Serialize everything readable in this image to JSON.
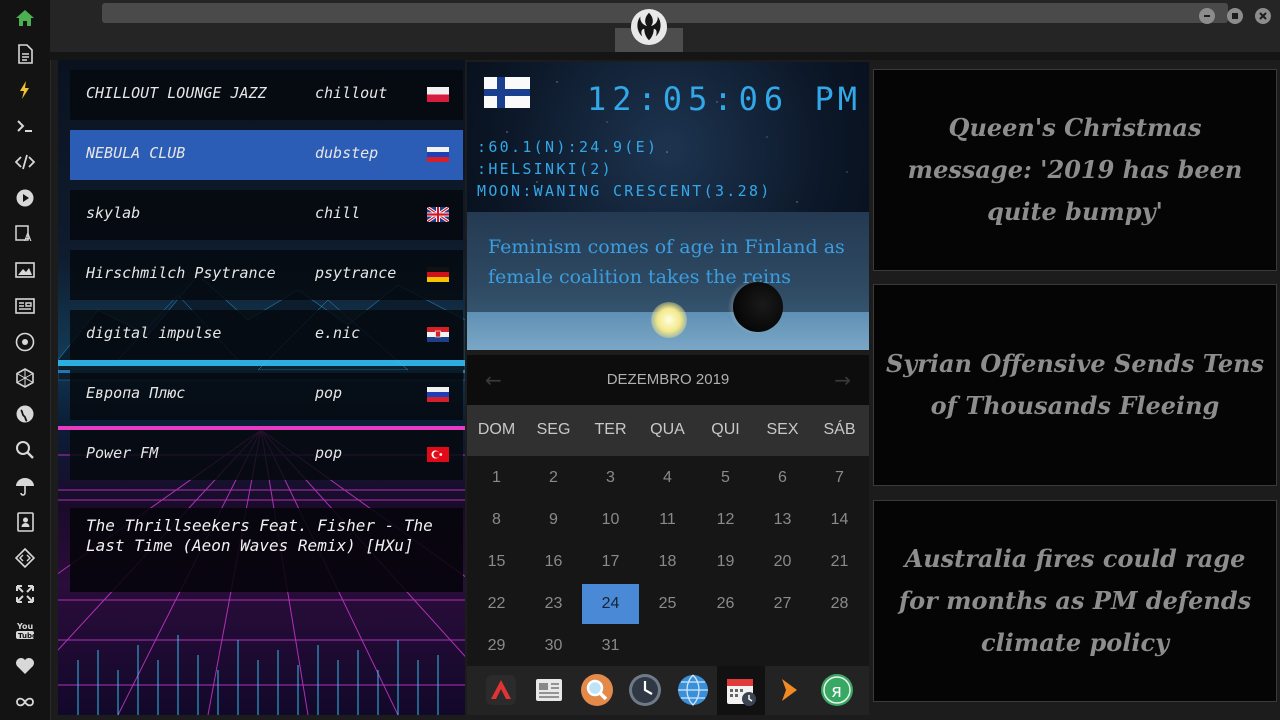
{
  "sidebar": {
    "items": [
      {
        "icon": "home-icon",
        "color": "#4caf50"
      },
      {
        "icon": "document-icon"
      },
      {
        "icon": "lightning-icon",
        "color": "#f4c430"
      },
      {
        "icon": "terminal-icon"
      },
      {
        "icon": "code-icon"
      },
      {
        "icon": "play-icon"
      },
      {
        "icon": "translate-icon"
      },
      {
        "icon": "image-icon"
      },
      {
        "icon": "news-icon"
      },
      {
        "icon": "rebel-icon"
      },
      {
        "icon": "hexagon-icon"
      },
      {
        "icon": "globe-icon"
      },
      {
        "icon": "search-icon"
      },
      {
        "icon": "umbrella-icon"
      },
      {
        "icon": "contacts-icon"
      },
      {
        "icon": "diamond-code-icon"
      },
      {
        "icon": "fullscreen-icon"
      },
      {
        "icon": "youtube-icon"
      },
      {
        "icon": "heart-icon"
      },
      {
        "icon": "infinity-icon"
      }
    ]
  },
  "radio": {
    "stations": [
      {
        "name": "CHILLOUT LOUNGE JAZZ",
        "genre": "chillout",
        "flag": "poland-flag"
      },
      {
        "name": "NEBULA CLUB",
        "genre": "dubstep",
        "flag": "russia-flag",
        "active": true
      },
      {
        "name": "skylab",
        "genre": "chill",
        "flag": "uk-flag"
      },
      {
        "name": "Hirschmilch Psytrance",
        "genre": "psytrance",
        "flag": "germany-flag"
      },
      {
        "name": "digital impulse",
        "genre": "e.nic",
        "flag": "croatia-flag"
      },
      {
        "name": "Европа Плюс",
        "genre": "pop",
        "flag": "russia-flag"
      },
      {
        "name": "Power FM",
        "genre": "pop",
        "flag": "turkey-flag"
      }
    ],
    "now_playing": "The Thrillseekers Feat. Fisher - The Last Time (Aeon Waves Remix) [HXu]"
  },
  "clock": {
    "time": "12:05:06",
    "ampm": "PM",
    "coords": ":60.1(N):24.9(E)",
    "city": ":HELSINKI(2)",
    "moon": "MOON:WANING CRESCENT(3.28)",
    "headline": "Feminism comes of age in Finland as female coalition takes the reins",
    "flag": "finland-flag"
  },
  "calendar": {
    "month": "DEZEMBRO 2019",
    "weekdays": [
      "DOM",
      "SEG",
      "TER",
      "QUA",
      "QUI",
      "SEX",
      "SÁB"
    ],
    "weeks": [
      [
        "1",
        "2",
        "3",
        "4",
        "5",
        "6",
        "7"
      ],
      [
        "8",
        "9",
        "10",
        "11",
        "12",
        "13",
        "14"
      ],
      [
        "15",
        "16",
        "17",
        "18",
        "19",
        "20",
        "21"
      ],
      [
        "22",
        "23",
        "24",
        "25",
        "26",
        "27",
        "28"
      ],
      [
        "29",
        "30",
        "31",
        "",
        "",
        "",
        ""
      ]
    ],
    "today": "24",
    "accent": "#4a89d6"
  },
  "dock": {
    "items": [
      "arch-app-icon",
      "newspaper-icon",
      "magnifier-icon",
      "clock-icon",
      "globe-icon",
      "calendar-icon",
      "arrow-icon",
      "yandex-icon"
    ],
    "active": "calendar-icon"
  },
  "news": [
    {
      "headline": "Queen's Christmas message: '2019 has been quite bumpy'"
    },
    {
      "headline": "Syrian Offensive Sends Tens of Thousands Fleeing"
    },
    {
      "headline": "Australia fires could rage for months as PM defends climate policy"
    }
  ]
}
